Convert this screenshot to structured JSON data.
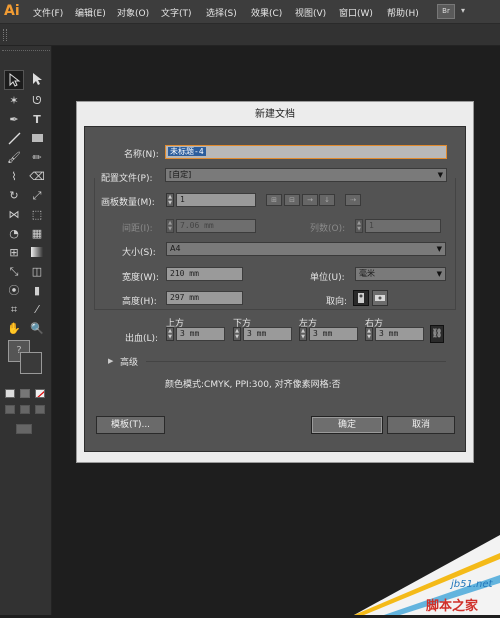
{
  "app": {
    "logo": "Ai",
    "br_button": "Br",
    "more": "▾"
  },
  "menu": [
    "文件(F)",
    "编辑(E)",
    "对象(O)",
    "文字(T)",
    "选择(S)",
    "效果(C)",
    "视图(V)",
    "窗口(W)",
    "帮助(H)"
  ],
  "dialog": {
    "title": "新建文档",
    "name_label": "名称(N):",
    "name_value": "未标题-4",
    "profile_label": "配置文件(P):",
    "profile_value": "[自定]",
    "artboards_label": "画板数量(M):",
    "artboards_value": "1",
    "spacing_label": "间距(I):",
    "spacing_value": "7.06 mm",
    "columns_label": "列数(O):",
    "columns_value": "1",
    "size_label": "大小(S):",
    "size_value": "A4",
    "width_label": "宽度(W):",
    "width_value": "210 mm",
    "units_label": "单位(U):",
    "units_value": "毫米",
    "height_label": "高度(H):",
    "height_value": "297 mm",
    "orientation_label": "取向:",
    "bleed_label": "出血(L):",
    "bleed": [
      {
        "label": "上方",
        "value": "3 mm"
      },
      {
        "label": "下方",
        "value": "3 mm"
      },
      {
        "label": "左方",
        "value": "3 mm"
      },
      {
        "label": "右方",
        "value": "3 mm"
      }
    ],
    "advanced_label": "高级",
    "summary": "颜色模式:CMYK, PPI:300, 对齐像素网格:否",
    "templates_button": "模板(T)...",
    "ok_button": "确定",
    "cancel_button": "取消"
  },
  "watermark": {
    "site": "jb51.net",
    "name": "脚本之家"
  }
}
